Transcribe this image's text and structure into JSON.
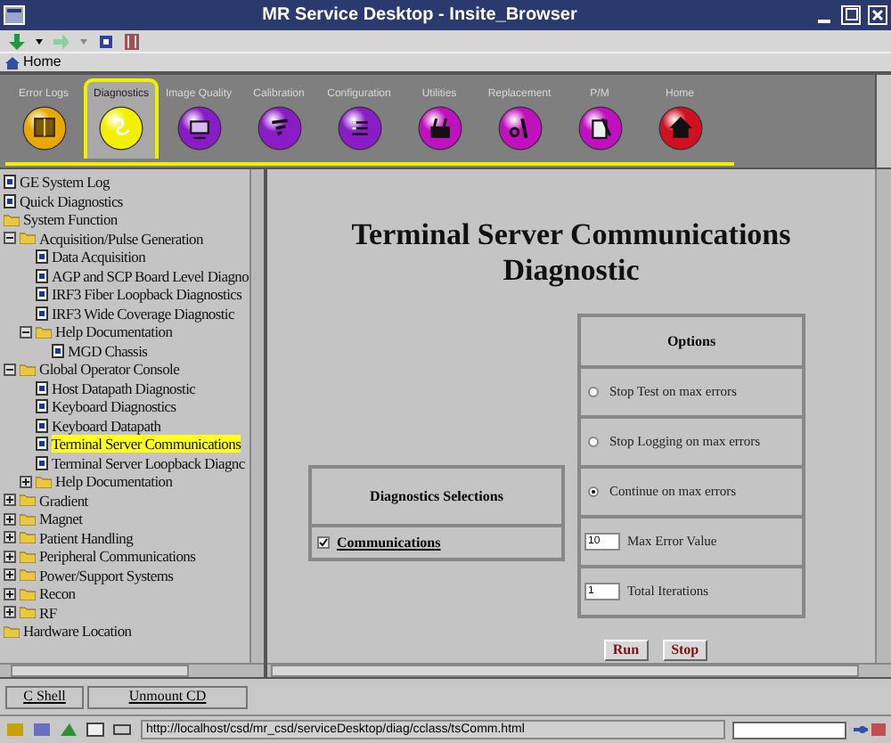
{
  "window": {
    "title": "MR Service Desktop - Insite_Browser"
  },
  "toolbar": {
    "home": "Home"
  },
  "tabs": [
    {
      "label": "Error Logs",
      "color": "#e8a800",
      "selected": false
    },
    {
      "label": "Diagnostics",
      "color": "#f0f000",
      "selected": true
    },
    {
      "label": "Image Quality",
      "color": "#8a1cc8",
      "selected": false
    },
    {
      "label": "Calibration",
      "color": "#8a1cc8",
      "selected": false
    },
    {
      "label": "Configuration",
      "color": "#8a1cc8",
      "selected": false
    },
    {
      "label": "Utilities",
      "color": "#c010c0",
      "selected": false
    },
    {
      "label": "Replacement",
      "color": "#c010c0",
      "selected": false
    },
    {
      "label": "P/M",
      "color": "#c010c0",
      "selected": false
    },
    {
      "label": "Home",
      "color": "#d01020",
      "selected": false
    }
  ],
  "tree": [
    {
      "kind": "leaf",
      "label": "GE System Log",
      "selected": false
    },
    {
      "kind": "leaf",
      "label": "Quick Diagnostics",
      "selected": false
    },
    {
      "kind": "group",
      "label": "System Function",
      "selected": false,
      "children": [
        {
          "kind": "folder",
          "label": "Acquisition/Pulse Generation",
          "expanded": true,
          "selected": false,
          "children": [
            {
              "kind": "leaf",
              "label": "Data Acquisition",
              "selected": false
            },
            {
              "kind": "leaf",
              "label": "AGP and SCP Board Level Diagno",
              "selected": false
            },
            {
              "kind": "leaf",
              "label": "IRF3 Fiber Loopback Diagnostics",
              "selected": false
            },
            {
              "kind": "leaf",
              "label": "IRF3 Wide Coverage Diagnostic",
              "selected": false
            },
            {
              "kind": "folder",
              "label": "Help Documentation",
              "expanded": true,
              "selected": false,
              "children": [
                {
                  "kind": "leaf",
                  "label": "MGD Chassis",
                  "selected": false
                }
              ]
            }
          ]
        },
        {
          "kind": "folder",
          "label": "Global Operator Console",
          "expanded": true,
          "selected": false,
          "children": [
            {
              "kind": "leaf",
              "label": "Host Datapath Diagnostic",
              "selected": false
            },
            {
              "kind": "leaf",
              "label": "Keyboard Diagnostics",
              "selected": false
            },
            {
              "kind": "leaf",
              "label": "Keyboard Datapath",
              "selected": false
            },
            {
              "kind": "leaf",
              "label": "Terminal Server Communications",
              "selected": true
            },
            {
              "kind": "leaf",
              "label": "Terminal Server Loopback Diagnc",
              "selected": false
            },
            {
              "kind": "folder",
              "label": "Help Documentation",
              "expanded": false,
              "selected": false
            }
          ]
        },
        {
          "kind": "folder",
          "label": "Gradient",
          "expanded": false,
          "selected": false
        },
        {
          "kind": "folder",
          "label": "Magnet",
          "expanded": false,
          "selected": false
        },
        {
          "kind": "folder",
          "label": "Patient Handling",
          "expanded": false,
          "selected": false
        },
        {
          "kind": "folder",
          "label": "Peripheral Communications",
          "expanded": false,
          "selected": false
        },
        {
          "kind": "folder",
          "label": "Power/Support Systems",
          "expanded": false,
          "selected": false
        },
        {
          "kind": "folder",
          "label": "Recon",
          "expanded": false,
          "selected": false
        },
        {
          "kind": "folder",
          "label": "RF",
          "expanded": false,
          "selected": false
        }
      ]
    },
    {
      "kind": "group",
      "label": "Hardware Location",
      "selected": false
    }
  ],
  "content": {
    "title": "Terminal Server Communications Diagnostic",
    "selections": {
      "title": "Diagnostics Selections",
      "items": [
        {
          "label": "Communications",
          "checked": true
        }
      ]
    },
    "options": {
      "title": "Options",
      "items": [
        {
          "kind": "radio",
          "label": "Stop Test on max errors",
          "selected": false
        },
        {
          "kind": "radio",
          "label": "Stop Logging on max errors",
          "selected": false
        },
        {
          "kind": "radio",
          "label": "Continue on max errors",
          "selected": true
        },
        {
          "kind": "number",
          "value": "10",
          "label": "Max Error Value"
        },
        {
          "kind": "number",
          "value": "1",
          "label": "Total Iterations"
        }
      ]
    },
    "buttons": [
      "Run",
      "Stop"
    ]
  },
  "bottom_buttons": [
    "C Shell",
    "Unmount CD"
  ],
  "status_bar": {
    "url": "http://localhost/csd/mr_csd/serviceDesktop/diag/cclass/tsComm.html"
  }
}
